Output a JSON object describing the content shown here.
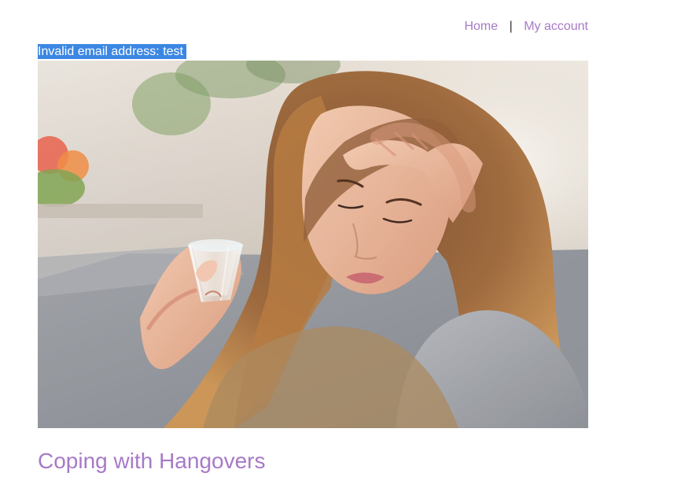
{
  "nav": {
    "home_label": "Home",
    "separator": "|",
    "account_label": "My account"
  },
  "alert": {
    "message": "Invalid email address: test"
  },
  "article": {
    "title": "Coping with Hangovers"
  },
  "colors": {
    "link": "#a77ac7",
    "alert_bg": "#3b87e3",
    "alert_text": "#ffffff"
  }
}
